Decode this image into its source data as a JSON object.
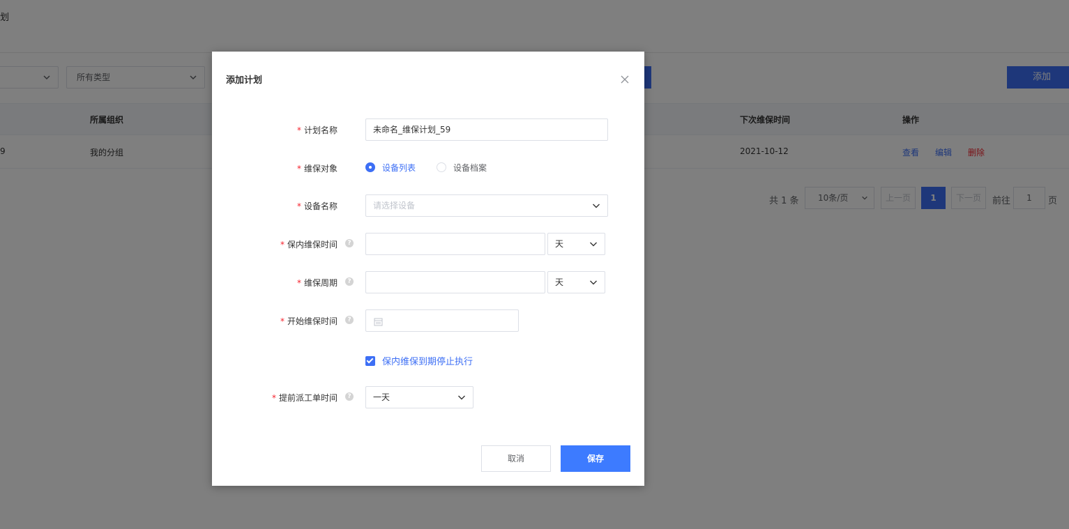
{
  "background": {
    "page_title": "划",
    "filter_select_1": "",
    "filter_select_2": "所有类型",
    "add_button": "添加",
    "table": {
      "columns": [
        "所属组织",
        "下次维保时间",
        "操作"
      ],
      "row": {
        "id_fragment": "9",
        "org": "我的分组",
        "next_date": "2021-10-12",
        "actions": [
          "查看",
          "编辑",
          "删除"
        ]
      }
    },
    "pagination": {
      "total": "共 1 条",
      "page_size": "10条/页",
      "prev": "上一页",
      "current": "1",
      "next": "下一页",
      "goto_label": "前往",
      "goto_value": "1",
      "goto_suffix": "页"
    }
  },
  "dialog": {
    "title": "添加计划",
    "fields": {
      "plan_name": {
        "label": "计划名称",
        "value": "未命名_维保计划_59"
      },
      "target": {
        "label": "维保对象",
        "options": [
          "设备列表",
          "设备档案"
        ],
        "selected": "设备列表"
      },
      "device_name": {
        "label": "设备名称",
        "placeholder": "请选择设备"
      },
      "warranty_time": {
        "label": "保内维保时间",
        "value": "",
        "unit": "天"
      },
      "cycle": {
        "label": "维保周期",
        "value": "",
        "unit": "天"
      },
      "start_time": {
        "label": "开始维保时间",
        "value": ""
      },
      "stop_checkbox": {
        "label": "保内维保到期停止执行",
        "checked": true
      },
      "advance_time": {
        "label": "提前派工单时间",
        "value": "一天"
      }
    },
    "required_mark": "*",
    "help_mark": "?",
    "cancel_label": "取消",
    "save_label": "保存"
  },
  "colors": {
    "primary": "#3d6ff5",
    "danger": "#f5222d",
    "mask": "rgba(0,0,0,0.5)"
  }
}
